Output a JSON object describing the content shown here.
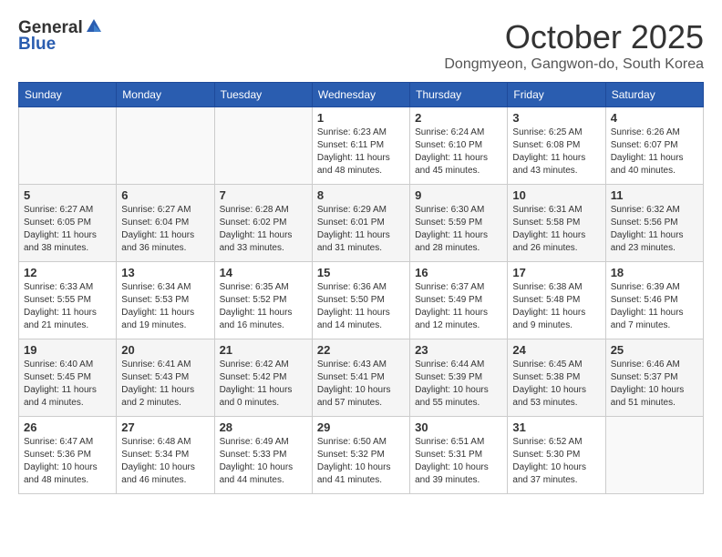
{
  "header": {
    "logo_general": "General",
    "logo_blue": "Blue",
    "month_title": "October 2025",
    "location": "Dongmyeon, Gangwon-do, South Korea"
  },
  "days_of_week": [
    "Sunday",
    "Monday",
    "Tuesday",
    "Wednesday",
    "Thursday",
    "Friday",
    "Saturday"
  ],
  "weeks": [
    [
      {
        "day": "",
        "info": ""
      },
      {
        "day": "",
        "info": ""
      },
      {
        "day": "",
        "info": ""
      },
      {
        "day": "1",
        "info": "Sunrise: 6:23 AM\nSunset: 6:11 PM\nDaylight: 11 hours and 48 minutes."
      },
      {
        "day": "2",
        "info": "Sunrise: 6:24 AM\nSunset: 6:10 PM\nDaylight: 11 hours and 45 minutes."
      },
      {
        "day": "3",
        "info": "Sunrise: 6:25 AM\nSunset: 6:08 PM\nDaylight: 11 hours and 43 minutes."
      },
      {
        "day": "4",
        "info": "Sunrise: 6:26 AM\nSunset: 6:07 PM\nDaylight: 11 hours and 40 minutes."
      }
    ],
    [
      {
        "day": "5",
        "info": "Sunrise: 6:27 AM\nSunset: 6:05 PM\nDaylight: 11 hours and 38 minutes."
      },
      {
        "day": "6",
        "info": "Sunrise: 6:27 AM\nSunset: 6:04 PM\nDaylight: 11 hours and 36 minutes."
      },
      {
        "day": "7",
        "info": "Sunrise: 6:28 AM\nSunset: 6:02 PM\nDaylight: 11 hours and 33 minutes."
      },
      {
        "day": "8",
        "info": "Sunrise: 6:29 AM\nSunset: 6:01 PM\nDaylight: 11 hours and 31 minutes."
      },
      {
        "day": "9",
        "info": "Sunrise: 6:30 AM\nSunset: 5:59 PM\nDaylight: 11 hours and 28 minutes."
      },
      {
        "day": "10",
        "info": "Sunrise: 6:31 AM\nSunset: 5:58 PM\nDaylight: 11 hours and 26 minutes."
      },
      {
        "day": "11",
        "info": "Sunrise: 6:32 AM\nSunset: 5:56 PM\nDaylight: 11 hours and 23 minutes."
      }
    ],
    [
      {
        "day": "12",
        "info": "Sunrise: 6:33 AM\nSunset: 5:55 PM\nDaylight: 11 hours and 21 minutes."
      },
      {
        "day": "13",
        "info": "Sunrise: 6:34 AM\nSunset: 5:53 PM\nDaylight: 11 hours and 19 minutes."
      },
      {
        "day": "14",
        "info": "Sunrise: 6:35 AM\nSunset: 5:52 PM\nDaylight: 11 hours and 16 minutes."
      },
      {
        "day": "15",
        "info": "Sunrise: 6:36 AM\nSunset: 5:50 PM\nDaylight: 11 hours and 14 minutes."
      },
      {
        "day": "16",
        "info": "Sunrise: 6:37 AM\nSunset: 5:49 PM\nDaylight: 11 hours and 12 minutes."
      },
      {
        "day": "17",
        "info": "Sunrise: 6:38 AM\nSunset: 5:48 PM\nDaylight: 11 hours and 9 minutes."
      },
      {
        "day": "18",
        "info": "Sunrise: 6:39 AM\nSunset: 5:46 PM\nDaylight: 11 hours and 7 minutes."
      }
    ],
    [
      {
        "day": "19",
        "info": "Sunrise: 6:40 AM\nSunset: 5:45 PM\nDaylight: 11 hours and 4 minutes."
      },
      {
        "day": "20",
        "info": "Sunrise: 6:41 AM\nSunset: 5:43 PM\nDaylight: 11 hours and 2 minutes."
      },
      {
        "day": "21",
        "info": "Sunrise: 6:42 AM\nSunset: 5:42 PM\nDaylight: 11 hours and 0 minutes."
      },
      {
        "day": "22",
        "info": "Sunrise: 6:43 AM\nSunset: 5:41 PM\nDaylight: 10 hours and 57 minutes."
      },
      {
        "day": "23",
        "info": "Sunrise: 6:44 AM\nSunset: 5:39 PM\nDaylight: 10 hours and 55 minutes."
      },
      {
        "day": "24",
        "info": "Sunrise: 6:45 AM\nSunset: 5:38 PM\nDaylight: 10 hours and 53 minutes."
      },
      {
        "day": "25",
        "info": "Sunrise: 6:46 AM\nSunset: 5:37 PM\nDaylight: 10 hours and 51 minutes."
      }
    ],
    [
      {
        "day": "26",
        "info": "Sunrise: 6:47 AM\nSunset: 5:36 PM\nDaylight: 10 hours and 48 minutes."
      },
      {
        "day": "27",
        "info": "Sunrise: 6:48 AM\nSunset: 5:34 PM\nDaylight: 10 hours and 46 minutes."
      },
      {
        "day": "28",
        "info": "Sunrise: 6:49 AM\nSunset: 5:33 PM\nDaylight: 10 hours and 44 minutes."
      },
      {
        "day": "29",
        "info": "Sunrise: 6:50 AM\nSunset: 5:32 PM\nDaylight: 10 hours and 41 minutes."
      },
      {
        "day": "30",
        "info": "Sunrise: 6:51 AM\nSunset: 5:31 PM\nDaylight: 10 hours and 39 minutes."
      },
      {
        "day": "31",
        "info": "Sunrise: 6:52 AM\nSunset: 5:30 PM\nDaylight: 10 hours and 37 minutes."
      },
      {
        "day": "",
        "info": ""
      }
    ]
  ]
}
